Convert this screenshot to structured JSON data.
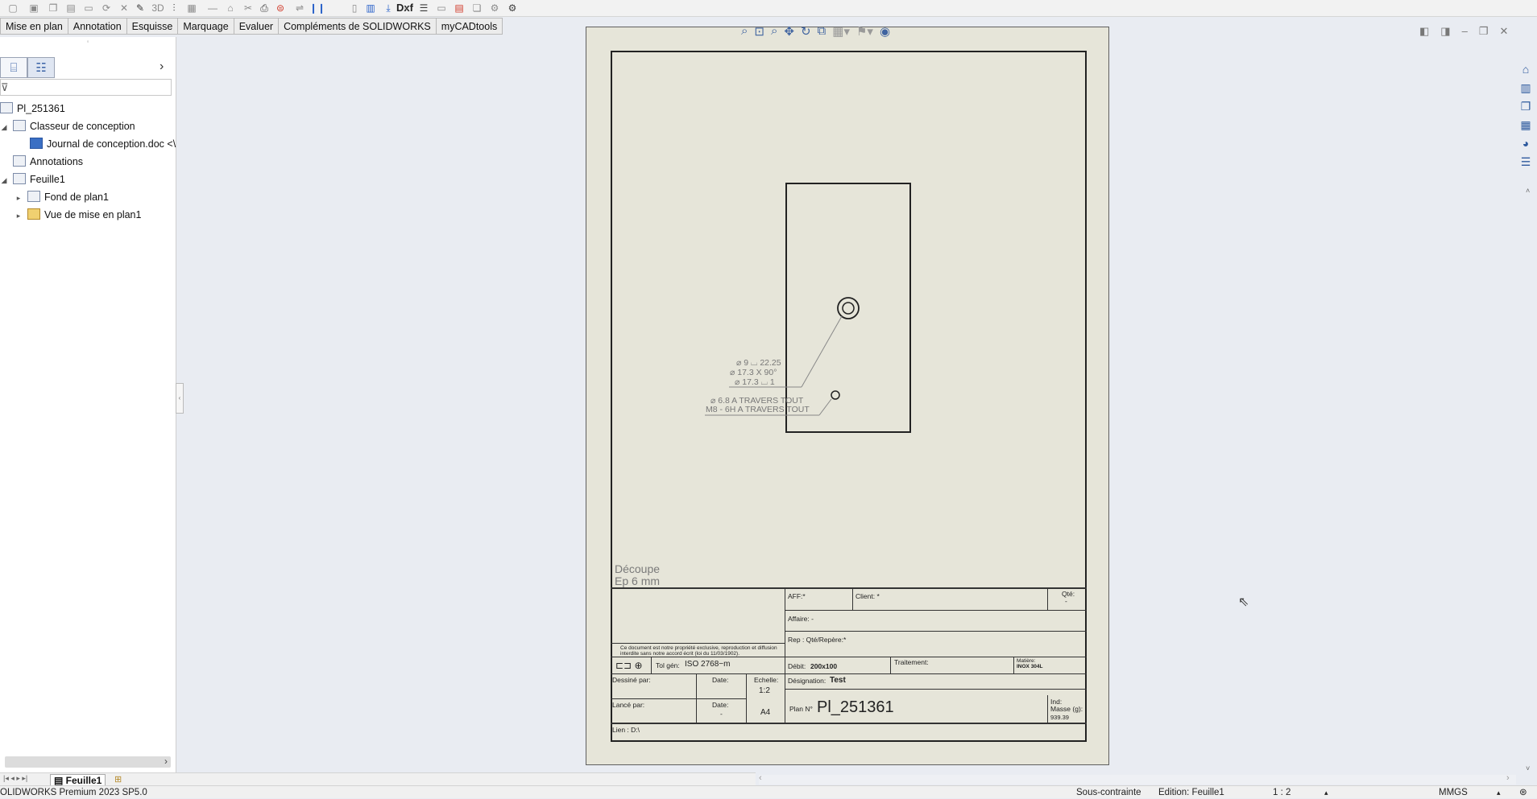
{
  "tabs": [
    "Mise en plan",
    "Annotation",
    "Esquisse",
    "Marquage",
    "Evaluer",
    "Compléments de SOLIDWORKS",
    "myCADtools"
  ],
  "toolbar": {
    "dxf_label": "Dxf"
  },
  "feature_tree": {
    "root": "Pl_251361",
    "items": [
      {
        "label": "Classeur de conception",
        "icon": "folder-icon"
      },
      {
        "label": "Journal de conception.doc <\\",
        "icon": "word-doc-icon"
      },
      {
        "label": "Annotations",
        "icon": "annotations-icon"
      },
      {
        "label": "Feuille1",
        "icon": "sheet-icon"
      },
      {
        "label": "Fond de plan1",
        "icon": "sheet-format-icon"
      },
      {
        "label": "Vue de mise en plan1",
        "icon": "drawing-view-icon"
      }
    ]
  },
  "drawing": {
    "callout1": {
      "line1": "⌀ 9 ⌴ 22.25",
      "line2": "⌀ 17.3 X 90°",
      "line3": "⌀ 17.3 ⌴ 1"
    },
    "callout2": {
      "line1": "⌀ 6.8 A TRAVERS TOUT",
      "line2": "M8 - 6H A TRAVERS TOUT"
    },
    "note": {
      "line1": "Découpe",
      "line2": "Ep 6 mm"
    }
  },
  "title_block": {
    "aff": "AFF:*",
    "client": "Client: *",
    "qte_label": "Qté:",
    "qte_value": "-",
    "affaire": "Affaire:  -",
    "rep": "Rep : Qté/Repère:*",
    "disclaimer": "Ce document est notre propriété exclusive, reproduction et diffusion interdite sans notre accord écrit (loi du 11/03/1902).",
    "tol": "Tol gén:",
    "tol_value": "ISO 2768−m",
    "debit_label": "Débit:",
    "debit_value": "200x100",
    "traitement": "Traitement:",
    "matiere_label": "Matière:",
    "matiere_value": "INOX 304L",
    "dessine": "Dessiné par:",
    "date1": "Date:",
    "echelle_label": "Echelle:",
    "echelle_value": "1:2",
    "designation_label": "Désignation:",
    "designation_value": "Test",
    "lance": "Lancé par:",
    "date2": "Date:",
    "date2_value": "-",
    "format": "A4",
    "plan_label": "Plan N°",
    "plan_value": "Pl_251361",
    "ind": "Ind:",
    "masse_label": "Masse (g):",
    "masse_value": "939.39",
    "lien": "Lien : D:\\"
  },
  "sheet_tab": "Feuille1",
  "status": {
    "product": "OLIDWORKS Premium 2023 SP5.0",
    "constraint": "Sous-contrainte",
    "edition": "Edition: Feuille1",
    "scale": "1 : 2",
    "units": "MMGS"
  }
}
